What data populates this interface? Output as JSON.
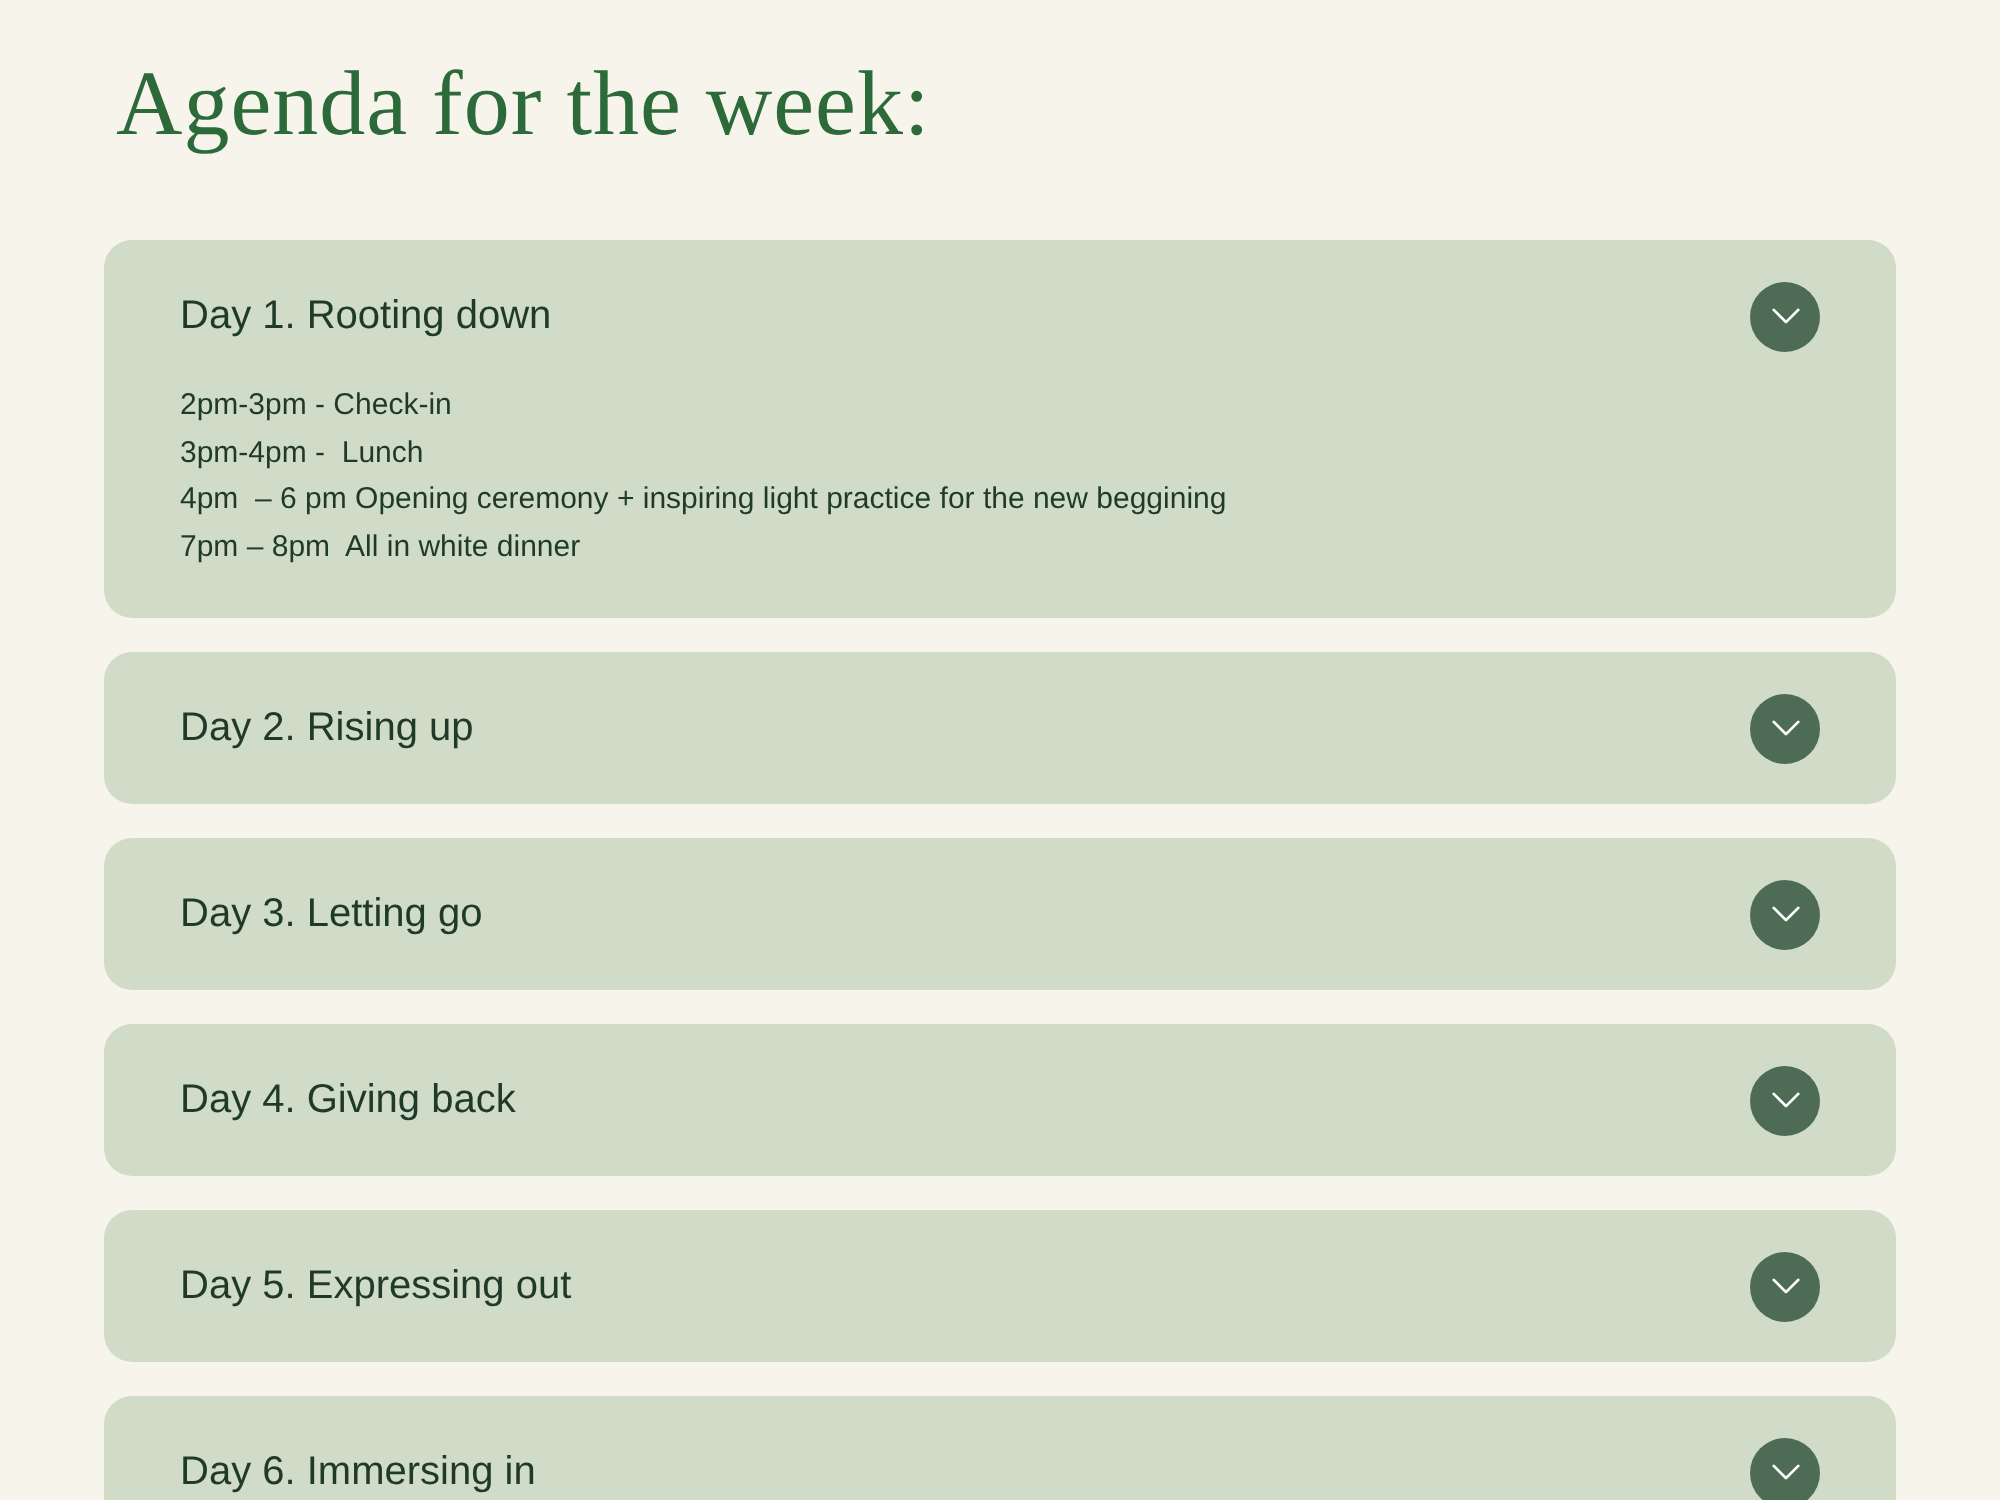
{
  "page": {
    "title": "Agenda for the week:"
  },
  "days": [
    {
      "title": "Day 1. Rooting down",
      "expanded": true,
      "items": [
        "2pm-3pm - Check-in",
        "3pm-4pm -  Lunch",
        "4pm  – 6 pm Opening ceremony + inspiring light practice for the new beggining",
        "7pm – 8pm  All in white dinner"
      ]
    },
    {
      "title": "Day 2. Rising up",
      "expanded": false
    },
    {
      "title": "Day 3. Letting go",
      "expanded": false
    },
    {
      "title": "Day 4. Giving back",
      "expanded": false
    },
    {
      "title": "Day 5. Expressing out",
      "expanded": false
    },
    {
      "title": "Day 6. Immersing in",
      "expanded": false
    }
  ]
}
